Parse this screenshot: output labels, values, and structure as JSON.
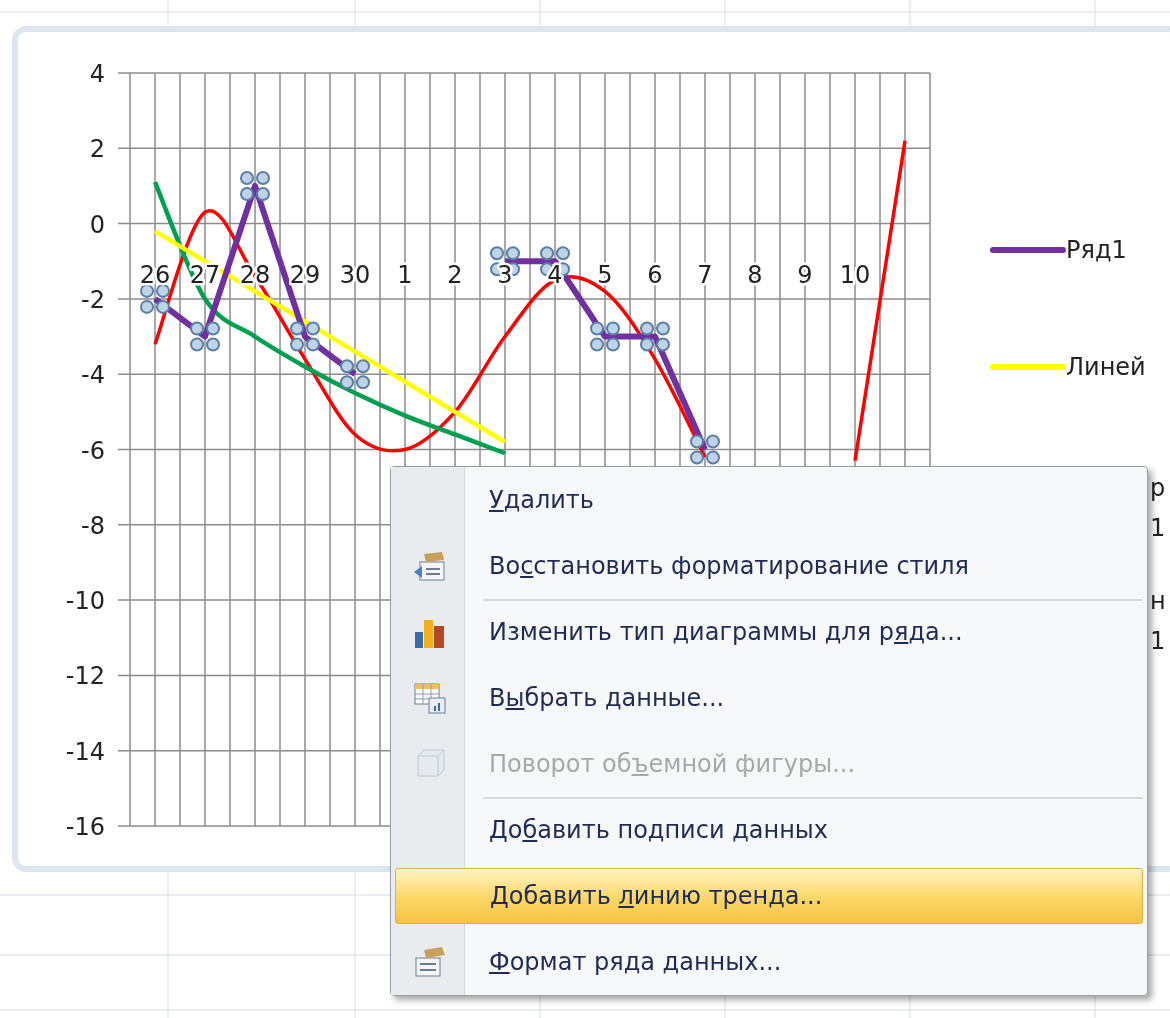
{
  "chart": {
    "chart_data": {
      "type": "line",
      "categories": [
        "26",
        "27",
        "28",
        "29",
        "30",
        "1",
        "2",
        "3",
        "4",
        "5",
        "6",
        "7",
        "8",
        "9",
        "10",
        null
      ],
      "yticks": [
        4,
        2,
        0,
        -2,
        -4,
        -6,
        -8,
        -10,
        -12,
        -14,
        -16
      ],
      "ylim": [
        -16,
        4
      ],
      "grid": true,
      "series": [
        {
          "name": "Ряд1",
          "color": "#7030a0",
          "values": [
            -2,
            -3,
            1,
            -3,
            -4,
            null,
            null,
            -1,
            -1,
            -3,
            -3,
            -6,
            null,
            null,
            null,
            null
          ]
        },
        {
          "name": "Линей",
          "color": "#ffff00",
          "values": [
            -0.2,
            -1.0,
            -1.8,
            -2.6,
            -3.4,
            -4.2,
            -5.0,
            -5.8,
            null,
            null,
            null,
            null,
            null,
            null,
            null,
            null
          ]
        },
        {
          "color": "#00a050",
          "values": [
            1.1,
            -2.0,
            -3.0,
            -3.8,
            -4.5,
            -5.1,
            -5.6,
            -6.1,
            null,
            null,
            null,
            null,
            null,
            null,
            null,
            null
          ]
        },
        {
          "color": "#ff0000",
          "values": [
            -3.2,
            0.3,
            -1.4,
            -3.6,
            -5.6,
            -6.0,
            -5.0,
            -3.0,
            -1.5,
            -1.8,
            -3.6,
            -6.2,
            null,
            null,
            -6.3,
            2.2
          ]
        }
      ]
    },
    "legend_fragments": [
      "р",
      "1",
      "н",
      "1"
    ]
  },
  "context_menu": [
    {
      "key": "У",
      "after": "далить",
      "kind": "plain",
      "disabled": false,
      "selected": false,
      "separator_before": false
    },
    {
      "before": "Во",
      "key": "с",
      "after": "становить форматирование стиля",
      "kind": "restore",
      "disabled": false,
      "selected": false,
      "separator_before": false
    },
    {
      "before": "Изменить тип диаграммы для р",
      "key": "я",
      "after": "да...",
      "kind": "chart-type",
      "disabled": false,
      "selected": false,
      "separator_before": true
    },
    {
      "before": "В",
      "key": "ы",
      "after": "брать данные...",
      "kind": "select-data",
      "disabled": false,
      "selected": false,
      "separator_before": false
    },
    {
      "before": "Поворот об",
      "key": "ъ",
      "after": "емной фигуры...",
      "kind": "rotate",
      "disabled": true,
      "selected": false,
      "separator_before": false
    },
    {
      "before": "До",
      "key": "б",
      "after": "авить подписи данных",
      "kind": "plain",
      "disabled": false,
      "selected": false,
      "separator_before": true
    },
    {
      "before": "Добавить ",
      "key": "л",
      "after": "инию тренда...",
      "kind": "plain",
      "disabled": false,
      "selected": true,
      "separator_before": false
    },
    {
      "key": "Ф",
      "after": "ормат ряда данных...",
      "kind": "format",
      "disabled": false,
      "selected": false,
      "separator_before": false
    }
  ]
}
